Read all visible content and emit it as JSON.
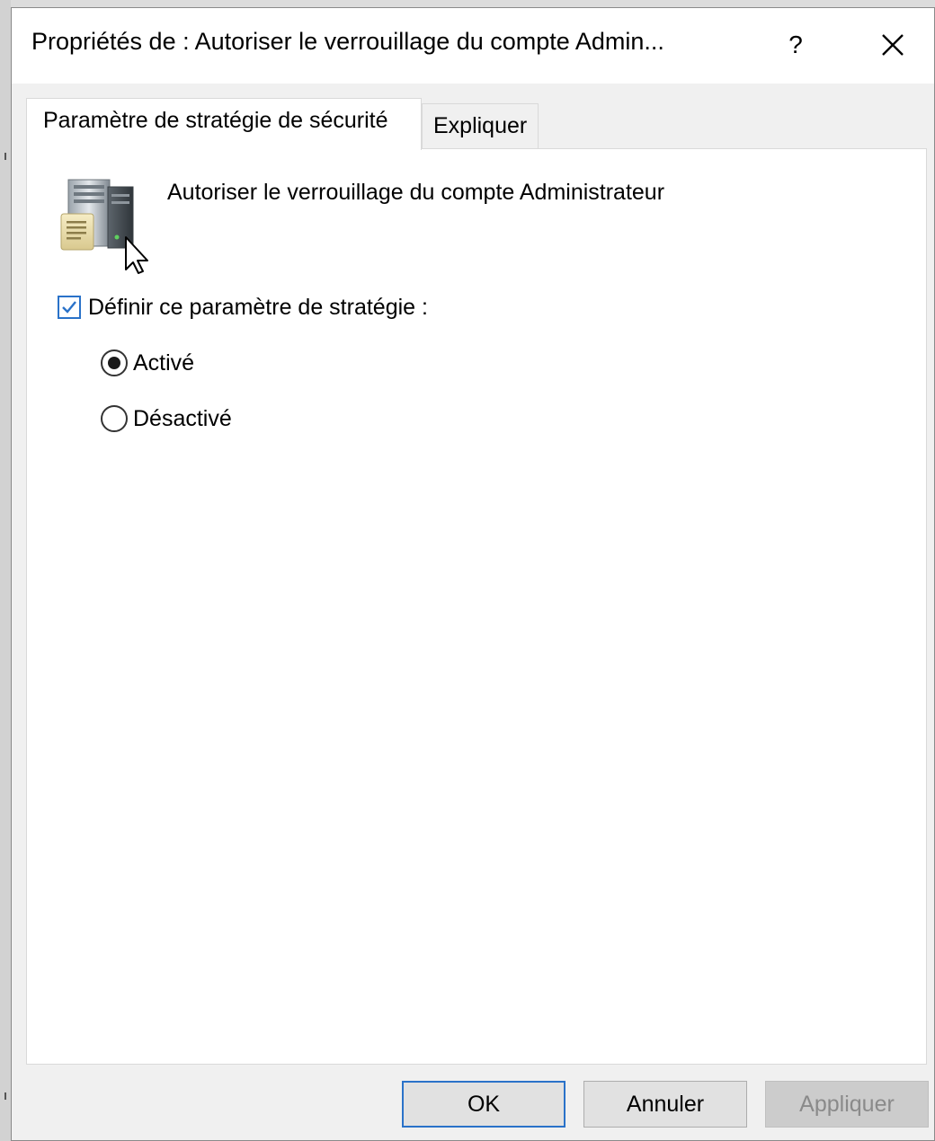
{
  "dialog": {
    "title": "Propriétés de : Autoriser le verrouillage du compte Admin...",
    "help_glyph": "?"
  },
  "tabs": [
    {
      "label": "Paramètre de stratégie de sécurité",
      "active": true
    },
    {
      "label": "Expliquer",
      "active": false
    }
  ],
  "policy": {
    "icon": "server-policy-icon",
    "name": "Autoriser le verrouillage du compte Administrateur"
  },
  "define_setting": {
    "label": "Définir ce paramètre de stratégie :",
    "checked": true
  },
  "options": [
    {
      "label": "Activé",
      "selected": true
    },
    {
      "label": "Désactivé",
      "selected": false
    }
  ],
  "buttons": {
    "ok": "OK",
    "cancel": "Annuler",
    "apply": "Appliquer"
  },
  "colors": {
    "accent": "#2a72c9",
    "disabled_text": "#8a8a8a",
    "panel_bg": "#ffffff",
    "dialog_bg": "#f0f0f0"
  }
}
